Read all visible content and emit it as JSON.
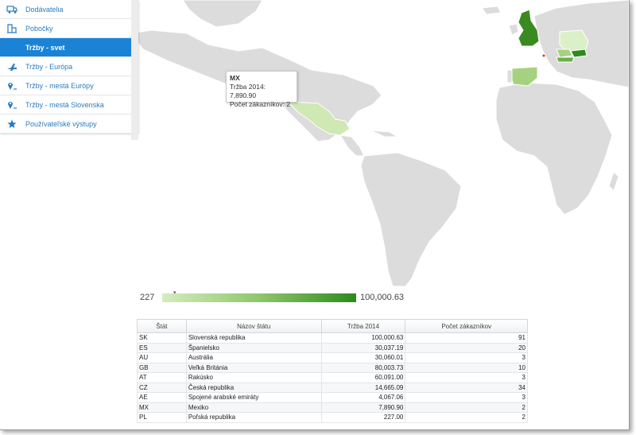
{
  "sidebar": {
    "items": [
      {
        "label": "Dodávatelia",
        "icon": "truck-icon",
        "active": false
      },
      {
        "label": "Pobočky",
        "icon": "building-icon",
        "active": false
      },
      {
        "label": "Tržby - svet",
        "icon": "",
        "active": true
      },
      {
        "label": "Tržby - Európa",
        "icon": "airplane-icon",
        "active": false
      },
      {
        "label": "Tržby - mestá Európy",
        "icon": "map-pin-icon",
        "active": false
      },
      {
        "label": "Tržby - mestá Slovenska",
        "icon": "map-pin-icon",
        "active": false
      },
      {
        "label": "Používateľské výstupy",
        "icon": "star-icon",
        "active": false
      }
    ]
  },
  "tooltip": {
    "code": "MX",
    "line1": "Tržba 2014: 7,890.90",
    "line2": "Počet zákazníkov: 2"
  },
  "legend": {
    "min": "227",
    "max": "100,000.63"
  },
  "colors": {
    "accent": "#1a83d6",
    "link": "#2a7bc0",
    "land": "#dcdcdc",
    "scale_low": "#d5ecbe",
    "scale_high": "#2d8a1e"
  },
  "table": {
    "headers": [
      "Štát",
      "Názov štátu",
      "Tržba 2014",
      "Počet zákazníkov"
    ],
    "rows": [
      {
        "code": "SK",
        "name": "Slovenská republika",
        "revenue": "100,000.63",
        "customers": "91"
      },
      {
        "code": "ES",
        "name": "Španielsko",
        "revenue": "30,037.19",
        "customers": "20"
      },
      {
        "code": "AU",
        "name": "Austrália",
        "revenue": "30,060.01",
        "customers": "3"
      },
      {
        "code": "GB",
        "name": "Veľká Británia",
        "revenue": "80,003.73",
        "customers": "10"
      },
      {
        "code": "AT",
        "name": "Rakúsko",
        "revenue": "60,091.00",
        "customers": "3"
      },
      {
        "code": "CZ",
        "name": "Česká republika",
        "revenue": "14,665.09",
        "customers": "34"
      },
      {
        "code": "AE",
        "name": "Spojené arabské emiráty",
        "revenue": "4,067.06",
        "customers": "3"
      },
      {
        "code": "MX",
        "name": "Mexiko",
        "revenue": "7,890.90",
        "customers": "2"
      },
      {
        "code": "PL",
        "name": "Poľská republika",
        "revenue": "227.00",
        "customers": "2"
      }
    ]
  }
}
